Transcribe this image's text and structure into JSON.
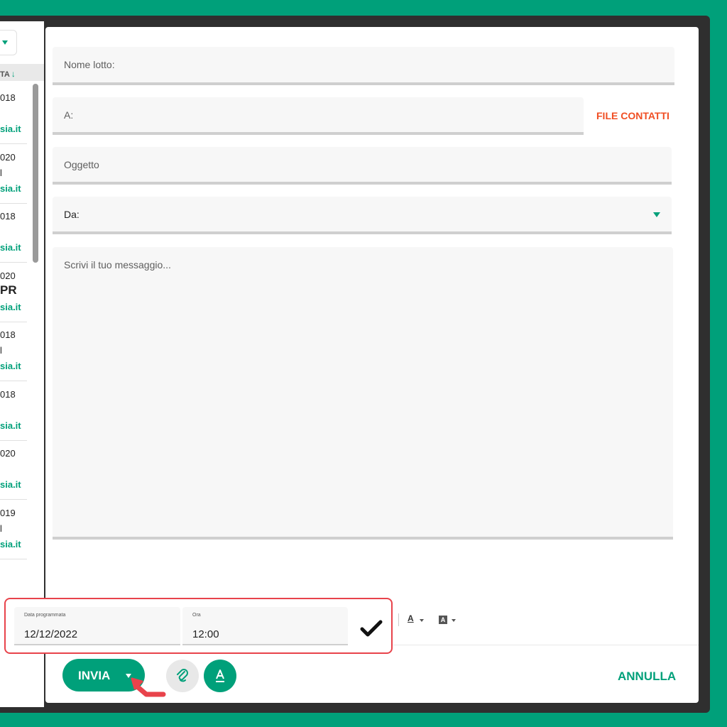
{
  "left_panel": {
    "sort_label": "TA",
    "items": [
      {
        "year": "018",
        "middle": "",
        "domain": "sia.it"
      },
      {
        "year": "020",
        "middle": "l",
        "domain": "sia.it"
      },
      {
        "year": "018",
        "middle": "",
        "domain": "sia.it"
      },
      {
        "year": "020",
        "middle": "PR",
        "domain": "sia.it",
        "big": true
      },
      {
        "year": "018",
        "middle": "l",
        "domain": "sia.it"
      },
      {
        "year": "018",
        "middle": "",
        "domain": "sia.it"
      },
      {
        "year": "020",
        "middle": "",
        "domain": "sia.it"
      },
      {
        "year": "019",
        "middle": "l",
        "domain": "sia.it"
      }
    ]
  },
  "compose": {
    "batch_name_placeholder": "Nome lotto:",
    "to_placeholder": "A:",
    "file_contacts_label": "FILE CONTATTI",
    "subject_placeholder": "Oggetto",
    "from_label": "Da:",
    "message_placeholder": "Scrivi il tuo messaggio..."
  },
  "schedule": {
    "date_label": "Data programmata",
    "date_value": "12/12/2022",
    "time_label": "Ora",
    "time_value": "12:00"
  },
  "actions": {
    "send_label": "INVIA",
    "cancel_label": "ANNULLA"
  },
  "format_tools": {
    "text_color_glyph": "A",
    "bg_color_glyph": "A"
  },
  "colors": {
    "accent": "#00a07a",
    "warning": "#f04e23",
    "highlight": "#e8434b"
  }
}
